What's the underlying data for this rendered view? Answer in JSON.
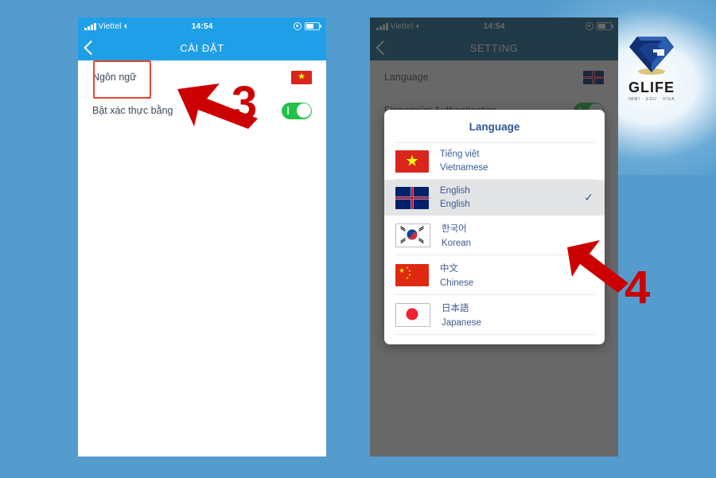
{
  "background": {
    "color": "#539ccd",
    "glow_color": "#ffffff"
  },
  "brand": {
    "name": "GLIFE",
    "tagline": "IMMI · EDU · VISA",
    "logo_icon": "diamond-g-logo",
    "color": "#1b3f8f"
  },
  "phone1": {
    "status_bar": {
      "carrier": "Viettel",
      "signal_icon": "signal-bars-icon",
      "wifi_icon": "wifi-icon",
      "time": "14:54",
      "lock_icon": "rotation-lock-icon",
      "battery_icon": "battery-icon"
    },
    "nav": {
      "back_icon": "chevron-left-icon",
      "title": "CÀI ĐẶT"
    },
    "rows": [
      {
        "label": "Ngôn ngữ",
        "control": "flag",
        "flag": "vietnam-flag-icon"
      },
      {
        "label": "Bật xác thực bằng",
        "control": "toggle",
        "toggle_on": true
      }
    ],
    "annotation": {
      "step": "3",
      "arrow_icon": "red-arrow-icon",
      "highlight_target": "Ngôn ngữ"
    }
  },
  "phone2": {
    "status_bar": {
      "carrier": "Viettel",
      "signal_icon": "signal-bars-icon",
      "wifi_icon": "wifi-icon",
      "time": "14:54",
      "lock_icon": "rotation-lock-icon",
      "battery_icon": "battery-icon"
    },
    "nav": {
      "back_icon": "chevron-left-icon",
      "title": "SETTING"
    },
    "rows": [
      {
        "label": "Language",
        "control": "flag",
        "flag": "uk-flag-icon"
      },
      {
        "label": "Fingerprint Authentication",
        "control": "toggle",
        "toggle_on": true
      }
    ],
    "dialog": {
      "title": "Language",
      "options": [
        {
          "native": "Tiếng việt",
          "english": "Vietnamese",
          "flag": "vietnam-flag-icon",
          "selected": false
        },
        {
          "native": "English",
          "english": "English",
          "flag": "uk-flag-icon",
          "selected": true
        },
        {
          "native": "한국어",
          "english": "Korean",
          "flag": "south-korea-flag-icon",
          "selected": false
        },
        {
          "native": "中文",
          "english": "Chinese",
          "flag": "china-flag-icon",
          "selected": false
        },
        {
          "native": "日本語",
          "english": "Japanese",
          "flag": "japan-flag-icon",
          "selected": false
        }
      ],
      "check_icon": "checkmark-icon"
    },
    "annotation": {
      "step": "4",
      "arrow_icon": "red-arrow-icon"
    }
  }
}
